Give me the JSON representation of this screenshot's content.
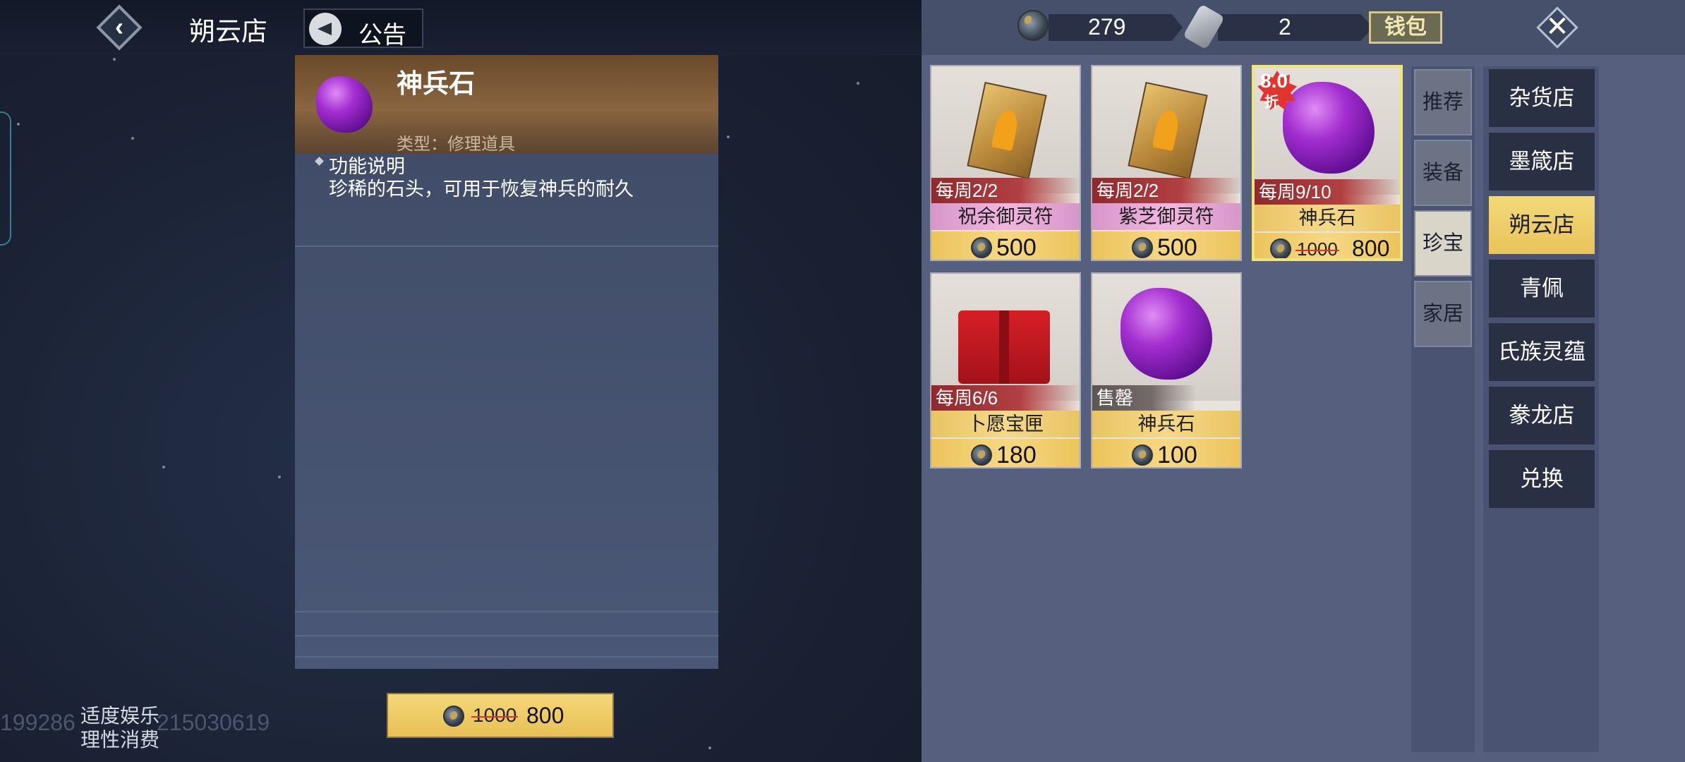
{
  "header": {
    "shop_title": "朔云店",
    "notice_label": "公告"
  },
  "detail": {
    "item_name": "神兵石",
    "item_type": "类型：修理道具",
    "func_title": "功能说明",
    "func_desc": "珍稀的石头，可用于恢复神兵的耐久",
    "buy_old_price": "1000",
    "buy_new_price": "800"
  },
  "footer": {
    "id_left": "199286",
    "id_right": "215030619",
    "tip_line1": "适度娱乐",
    "tip_line2": "理性消费"
  },
  "currency": {
    "coin_value": "279",
    "token_value": "2",
    "wallet_label": "钱包"
  },
  "items": [
    {
      "limit": "每周2/2",
      "name": "祝余御灵符",
      "price": "500"
    },
    {
      "limit": "每周2/2",
      "name": "紫芝御灵符",
      "price": "500"
    },
    {
      "limit": "每周9/10",
      "name": "神兵石",
      "old_price": "1000",
      "price": "800",
      "discount": "8.0",
      "discount_unit": "折"
    },
    {
      "limit": "每周6/6",
      "name": "卜愿宝匣",
      "price": "180"
    },
    {
      "limit": "售罄",
      "name": "神兵石",
      "price": "100"
    }
  ],
  "sub_tabs": [
    "推荐",
    "装备",
    "珍宝",
    "家居"
  ],
  "active_sub_tab": "珍宝",
  "shop_tabs": [
    "杂货店",
    "墨箴店",
    "朔云店",
    "青佩",
    "氏族灵蕴",
    "豢龙店",
    "兑换"
  ],
  "active_shop_tab": "朔云店"
}
